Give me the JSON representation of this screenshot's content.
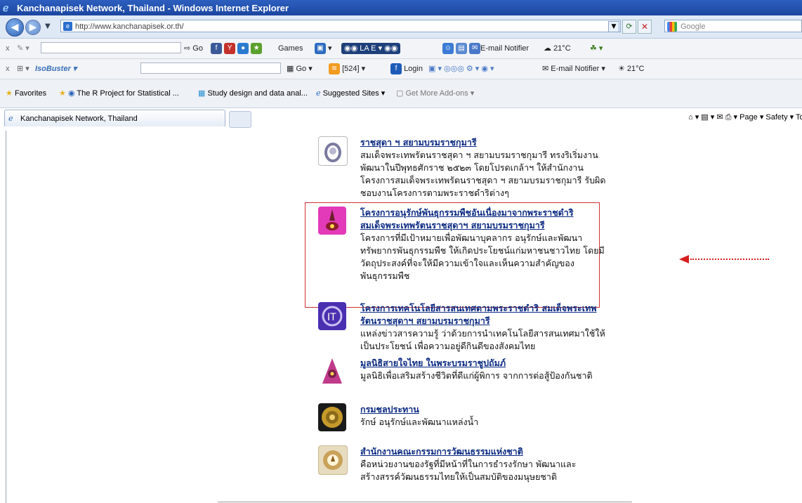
{
  "window": {
    "title": "Kanchanapisek Network, Thailand - Windows Internet Explorer"
  },
  "address": {
    "url": "http://www.kanchanapisek.or.th/",
    "search_placeholder": "Google"
  },
  "toolbar1": {
    "go": "Go",
    "games": "Games",
    "lae": "LA E",
    "email_notifier": "E-mail Notifier",
    "temp": "21°C"
  },
  "toolbar2": {
    "isobuster": "IsoBuster",
    "go": "Go",
    "count": "[524]",
    "login": "Login",
    "email_notifier": "E-mail Notifier",
    "temp": "21°C"
  },
  "favorites": {
    "label": "Favorites",
    "items": [
      "The R Project for Statistical ...",
      "Study design and data anal...",
      "Suggested Sites",
      "Get More Add-ons"
    ]
  },
  "tab": {
    "title": "Kanchanapisek Network, Thailand"
  },
  "command_bar": {
    "page": "Page",
    "safety": "Safety",
    "tools": "To"
  },
  "items": [
    {
      "title": "ราชสุดา ฯ สยามบรมราชกุมารี",
      "desc": "สมเด็จพระเทพรัตนราชสุดา ฯ สยามบรมราชกุมารี ทรงริเริ่มงานพัฒนาในปีพุทธศักราช ๒๕๒๓ โดยโปรดเกล้าฯ ให้สำนักงานโครงการสมเด็จพระเทพรัตนราชสุดา ฯ สยามบรมราชกุมารี รับผิดชอบงานโครงการตามพระราชดำริต่างๆ",
      "color": "#7a7aa0"
    },
    {
      "title": "โครงการอนุรักษ์พันธุกรรมพืชอันเนื่องมาจากพระราชดำริ",
      "subtitle": "สมเด็จพระเทพรัตนราชสุดาฯ สยามบรมราชกุมารี",
      "desc": "โครงการที่มีเป้าหมายเพื่อพัฒนาบุคลากร อนุรักษ์และพัฒนาทรัพยากรพันธุกรรมพืช ให้เกิดประโยชน์แก่มหาชนชาวไทย โดยมีวัตถุประสงค์ที่จะให้มีความเข้าใจและเห็นความสำคัญของพันธุกรรมพืช",
      "color": "#e23ab8"
    },
    {
      "title": "โครงการเทคโนโลยีสารสนเทศตามพระราชดำริ สมเด็จพระเทพรัตนราชสุดาฯ สยามบรมราชกุมารี",
      "desc": "แหล่งข่าวสารความรู้ ว่าด้วยการนำเทคโนโลยีสารสนเทศมาใช้ให้เป็นประโยชน์ เพื่อความอยู่ดีกินดีของสังคมไทย",
      "color": "#4a2fb0"
    },
    {
      "title": "มูลนิธิสายใจไทย ในพระบรมราชูปถัมภ์",
      "desc": "มูลนิธิเพื่อเสริมสร้างชีวิตที่ดีแก่ผู้พิการ จากการต่อสู้ป้องกันชาติ",
      "color": "#c03a8a"
    },
    {
      "title": "กรมชลประทาน",
      "desc": "รักษ์ อนุรักษ์และพัฒนาแหล่งน้ำ",
      "color": "#c69a2a"
    },
    {
      "title": "สำนักงานคณะกรรมการวัฒนธรรมแห่งชาติ",
      "desc": "คือหน่วยงานของรัฐที่มีหน้าที่ในการธำรงรักษา พัฒนาและสร้างสรรค์วัฒนธรรมไทยให้เป็นสมบัติของมนุษยชาติ",
      "color": "#c9a25a"
    }
  ]
}
